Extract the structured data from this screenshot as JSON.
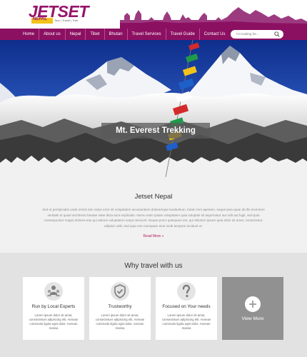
{
  "brand": {
    "name": "JETSET",
    "sub": "NEPAL",
    "tags": "Tour | Travel | Trek"
  },
  "nav": {
    "items": [
      "Home",
      "About us",
      "Nepal",
      "Tibet",
      "Bhutan",
      "Travel Services",
      "Travel Guide",
      "Contact Us"
    ]
  },
  "search": {
    "placeholder": "I'm looking for..."
  },
  "hero": {
    "caption": "Mt. Everest Trekking"
  },
  "intro": {
    "title": "Jetset Nepal",
    "body": "Sed ut perspiciatis unde omnis iste natus error sit voluptatem accusantium doloremque laudantium, totam rem aperiam, eaque ipsa quae ab illo inventore veritatis et quasi architecto beatae vitae dicta sunt explicabo. Nemo enim ipsam voluptatem quia voluptas sit aspernatur aut odit aut fugit, sed quia consequuntur magni dolores eos qui ratione voluptatem sequi nesciunt. Neque porro quisquam est, qui dolorem ipsum quia dolor sit amet, consectetur, adipisci velit, sed quia non numquam eius modi tempora incidunt ut.",
    "link": "Read More »"
  },
  "why": {
    "title": "Why travel with us",
    "cards": [
      {
        "title": "Run by Local Experts",
        "body": "Lorem ipsum dolor sit amet, consectetuer adipiscing elit. Aenean commodo ligula eget dolor. Aenean massa",
        "icon": "local-experts-icon"
      },
      {
        "title": "Trustworthy",
        "body": "Lorem ipsum dolor sit amet, consectetuer adipiscing elit. Aenean commodo ligula eget dolor. Aenean massa",
        "icon": "shield-check-icon"
      },
      {
        "title": "Focused on Your needs",
        "body": "Lorem ipsum dolor sit amet, consectetuer adipiscing elit. Aenean commodo ligula eget dolor. Aenean massa",
        "icon": "question-icon"
      }
    ],
    "view_more": "View More"
  },
  "colors": {
    "brand": "#8c1062",
    "accent": "#f2c21b",
    "link": "#b5155f"
  }
}
